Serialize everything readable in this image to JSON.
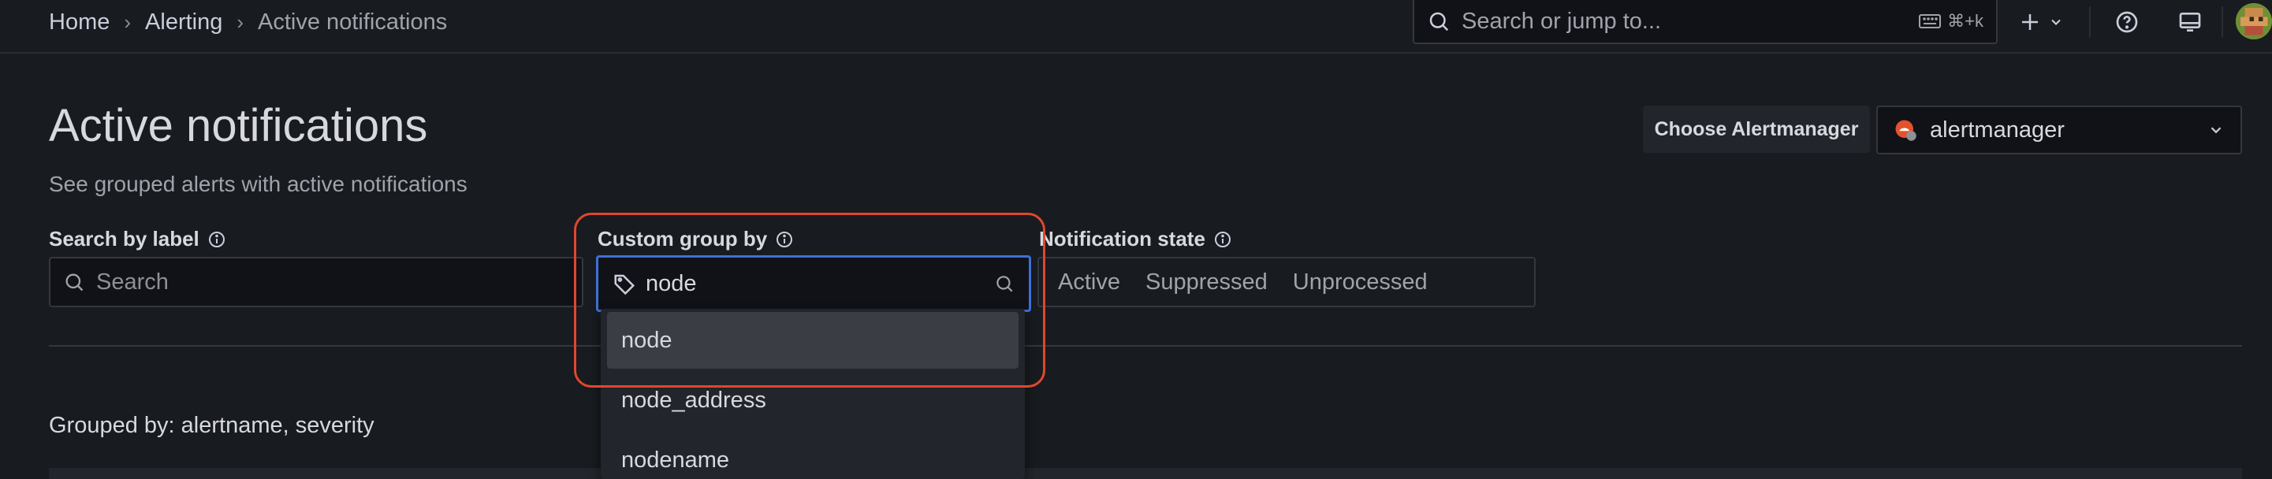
{
  "breadcrumb": {
    "items": [
      "Home",
      "Alerting",
      "Active notifications"
    ],
    "separator": "›"
  },
  "topsearch": {
    "placeholder": "Search or jump to...",
    "shortcut": "⌘+k"
  },
  "page": {
    "title": "Active notifications",
    "subtitle": "See grouped alerts with active notifications"
  },
  "alertmanager": {
    "label": "Choose Alertmanager",
    "selected": "alertmanager"
  },
  "filters": {
    "search_label": "Search by label",
    "search_placeholder": "Search",
    "group_label": "Custom group by",
    "group_value": "node",
    "state_label": "Notification state",
    "states": [
      "Active",
      "Suppressed",
      "Unprocessed"
    ]
  },
  "dropdown": {
    "options": [
      "node",
      "node_address",
      "nodename"
    ],
    "selected": "node"
  },
  "grouped_by": "Grouped by: alertname, severity",
  "colors": {
    "accent_focus": "#3d71d9",
    "highlight": "#e0472e",
    "background": "#181b1f"
  }
}
